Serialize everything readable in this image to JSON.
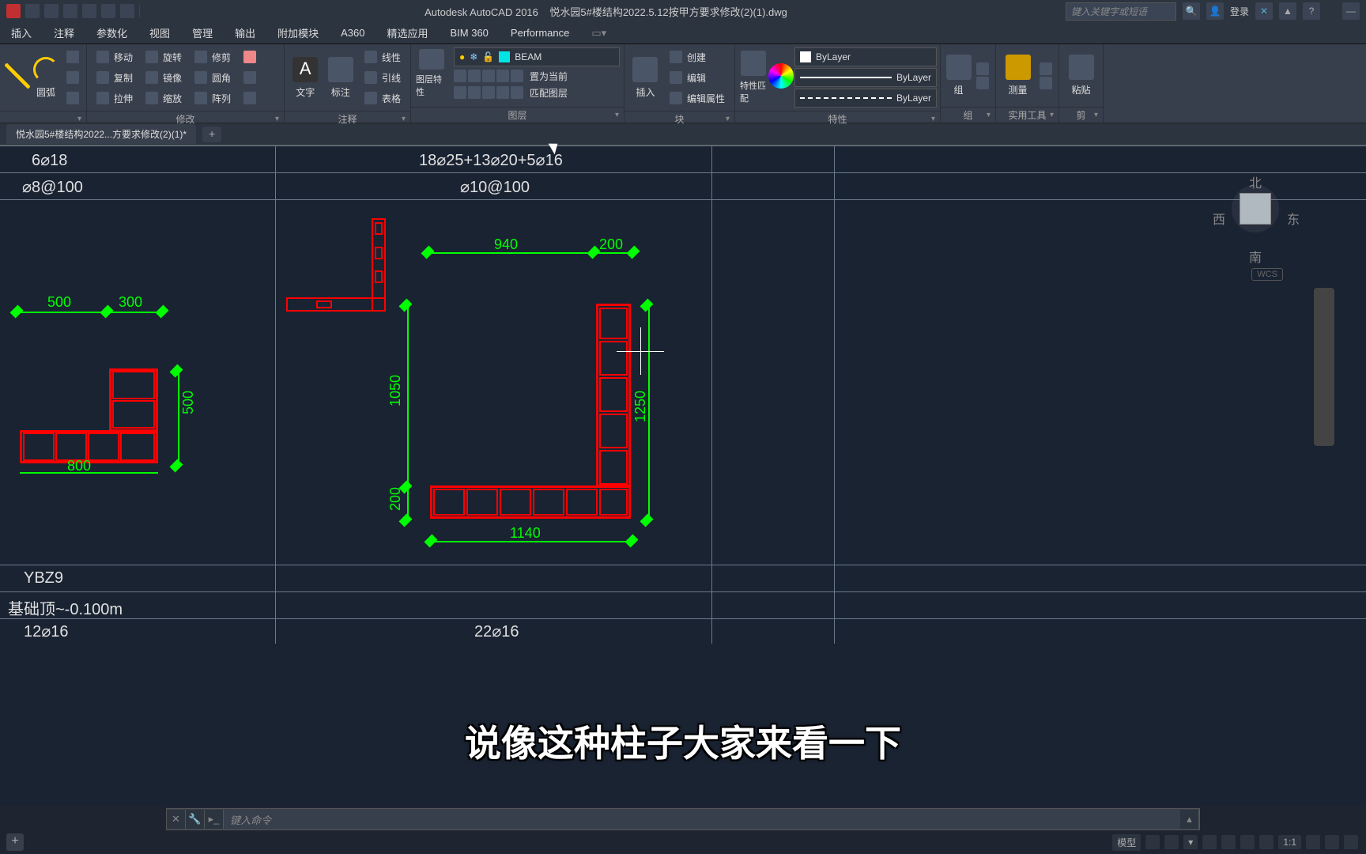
{
  "title": {
    "app": "Autodesk AutoCAD 2016",
    "file": "悦水园5#楼结构2022.5.12按甲方要求修改(2)(1).dwg"
  },
  "search_placeholder": "键入关键字或短语",
  "login": "登录",
  "menu": [
    "插入",
    "注释",
    "参数化",
    "视图",
    "管理",
    "输出",
    "附加模块",
    "A360",
    "精选应用",
    "BIM 360",
    "Performance"
  ],
  "ribbon": {
    "draw": {
      "arc": "圆弧"
    },
    "modify": {
      "label": "修改",
      "move": "移动",
      "copy": "复制",
      "stretch": "拉伸",
      "rotate": "旋转",
      "mirror": "镜像",
      "scale": "缩放",
      "trim": "修剪",
      "fillet": "圆角",
      "array": "阵列"
    },
    "annotate": {
      "label": "注释",
      "text": "文字",
      "dim": "标注",
      "table": "表格",
      "linear": "线性",
      "leader": "引线"
    },
    "layers": {
      "label": "图层",
      "props": "图层特性",
      "current": "BEAM",
      "makecur": "置为当前",
      "match": "匹配图层"
    },
    "block": {
      "label": "块",
      "insert": "插入",
      "create": "创建",
      "edit": "编辑",
      "attr": "编辑属性"
    },
    "props": {
      "label": "特性",
      "match": "特性匹配",
      "bylayer": "ByLayer"
    },
    "group": {
      "label": "组",
      "btn": "组"
    },
    "util": {
      "label": "实用工具",
      "measure": "测量"
    },
    "clip": {
      "label": "剪",
      "paste": "粘贴"
    }
  },
  "filetab": "悦水园5#楼结构2022...方要求修改(2)(1)*",
  "table": {
    "r1c1": "6⌀18",
    "r1c2": "18⌀25+13⌀20+5⌀16",
    "r2c1": "⌀8@100",
    "r2c2": "⌀10@100",
    "r3c1": "YBZ9",
    "r4c1": "基础顶~-0.100m",
    "r5c1": "12⌀16",
    "r5c2": "22⌀16"
  },
  "dims": {
    "d500": "500",
    "d300": "300",
    "d500v": "500",
    "d800": "800",
    "d940": "940",
    "d200": "200",
    "d1050": "1050",
    "d1250": "1250",
    "d200v": "200",
    "d1140": "1140"
  },
  "viewcube": {
    "n": "北",
    "s": "南",
    "e": "东",
    "w": "西",
    "wcs": "WCS"
  },
  "cmdline": "键入命令",
  "status": {
    "model": "模型",
    "scale": "1:1"
  },
  "subtitle": "说像这种柱子大家来看一下"
}
